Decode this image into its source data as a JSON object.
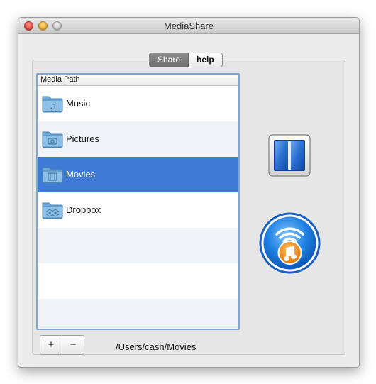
{
  "window": {
    "title": "MediaShare"
  },
  "tabs": [
    {
      "label": "Share",
      "selected": true
    },
    {
      "label": "help",
      "selected": false
    }
  ],
  "list": {
    "header": "Media Path",
    "items": [
      {
        "label": "Music",
        "icon": "music-folder-icon"
      },
      {
        "label": "Pictures",
        "icon": "pictures-folder-icon"
      },
      {
        "label": "Movies",
        "icon": "movies-folder-icon",
        "selected": true
      },
      {
        "label": "Dropbox",
        "icon": "dropbox-folder-icon"
      }
    ]
  },
  "buttons": {
    "add": "+",
    "remove": "−"
  },
  "path": "/Users/cash/Movies",
  "colors": {
    "selection": "#3e7ad6",
    "focus_ring": "#7ea6d8",
    "alt_row": "#f0f4f9"
  }
}
